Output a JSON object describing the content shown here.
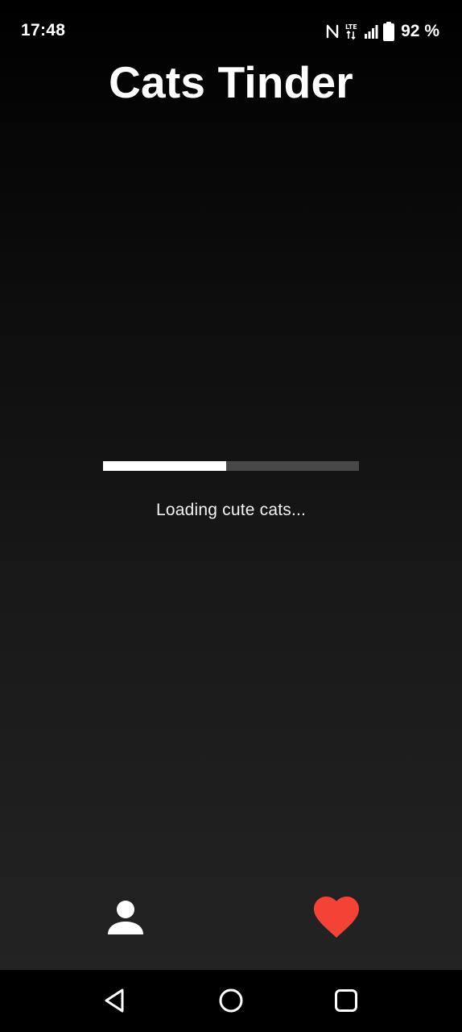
{
  "status_bar": {
    "time": "17:48",
    "battery_percent": "92 %",
    "icons": [
      "nfc-icon",
      "lte-icon",
      "signal-icon",
      "battery-icon"
    ]
  },
  "app": {
    "title": "Cats Tinder"
  },
  "loading": {
    "progress": 0.48,
    "text": "Loading cute cats..."
  },
  "bottom_nav": {
    "items": [
      {
        "icon": "person-icon",
        "color": "#ffffff"
      },
      {
        "icon": "heart-icon",
        "color": "#f44336"
      }
    ]
  },
  "system_nav": {
    "items": [
      "back-icon",
      "home-icon",
      "recents-icon"
    ]
  },
  "colors": {
    "background_top": "#000000",
    "background_bottom": "#232323",
    "progress_track": "#484848",
    "progress_fill": "#ffffff",
    "accent_heart": "#f44336"
  }
}
